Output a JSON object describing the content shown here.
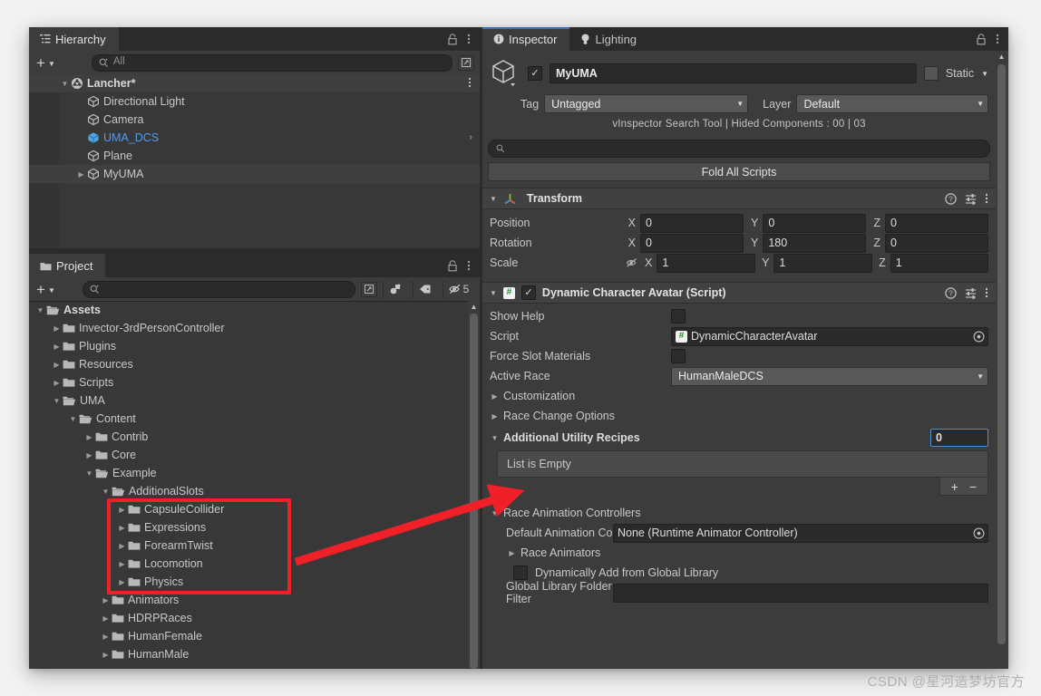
{
  "hierarchy": {
    "tab_label": "Hierarchy",
    "tab_icon": "hierarchy-icon",
    "lock_icon": "lock-icon",
    "menu_icon": "kebab-menu-icon",
    "add_label": "+",
    "search_placeholder": "All",
    "items": [
      {
        "label": "Lancher*",
        "depth": 0,
        "arrow": "down",
        "icon": "unity-scene-icon",
        "bold": true,
        "kebab": true
      },
      {
        "label": "Directional Light",
        "depth": 1,
        "arrow": "none",
        "icon": "gameobject-icon"
      },
      {
        "label": "Camera",
        "depth": 1,
        "arrow": "none",
        "icon": "gameobject-icon"
      },
      {
        "label": "UMA_DCS",
        "depth": 1,
        "arrow": "none",
        "icon": "prefab-icon",
        "color": "#4e9bf0",
        "chevron": true
      },
      {
        "label": "Plane",
        "depth": 1,
        "arrow": "none",
        "icon": "gameobject-icon"
      },
      {
        "label": "MyUMA",
        "depth": 1,
        "arrow": "right",
        "icon": "gameobject-icon",
        "selected": true
      }
    ]
  },
  "project": {
    "tab_label": "Project",
    "tab_icon": "folder-icon",
    "lock_icon": "lock-icon",
    "menu_icon": "kebab-menu-icon",
    "add_label": "+",
    "search_placeholder": "",
    "toolbar_icons": [
      "save-search-icon",
      "label-filter-icon",
      "hidden-toggle-icon"
    ],
    "hidden_count": "5",
    "items": [
      {
        "label": "Assets",
        "depth": 0,
        "arrow": "down",
        "icon": "folder-open-icon",
        "bold": true
      },
      {
        "label": "Invector-3rdPersonController",
        "depth": 1,
        "arrow": "right",
        "icon": "folder-icon"
      },
      {
        "label": "Plugins",
        "depth": 1,
        "arrow": "right",
        "icon": "folder-icon"
      },
      {
        "label": "Resources",
        "depth": 1,
        "arrow": "right",
        "icon": "folder-icon"
      },
      {
        "label": "Scripts",
        "depth": 1,
        "arrow": "right",
        "icon": "folder-icon"
      },
      {
        "label": "UMA",
        "depth": 1,
        "arrow": "down",
        "icon": "folder-open-icon"
      },
      {
        "label": "Content",
        "depth": 2,
        "arrow": "down",
        "icon": "folder-open-icon"
      },
      {
        "label": "Contrib",
        "depth": 3,
        "arrow": "right",
        "icon": "folder-icon"
      },
      {
        "label": "Core",
        "depth": 3,
        "arrow": "right",
        "icon": "folder-icon"
      },
      {
        "label": "Example",
        "depth": 3,
        "arrow": "down",
        "icon": "folder-open-icon"
      },
      {
        "label": "AdditionalSlots",
        "depth": 4,
        "arrow": "down",
        "icon": "folder-open-icon"
      },
      {
        "label": "CapsuleCollider",
        "depth": 5,
        "arrow": "right",
        "icon": "folder-icon"
      },
      {
        "label": "Expressions",
        "depth": 5,
        "arrow": "right",
        "icon": "folder-icon"
      },
      {
        "label": "ForearmTwist",
        "depth": 5,
        "arrow": "right",
        "icon": "folder-icon"
      },
      {
        "label": "Locomotion",
        "depth": 5,
        "arrow": "right",
        "icon": "folder-icon"
      },
      {
        "label": "Physics",
        "depth": 5,
        "arrow": "right",
        "icon": "folder-icon"
      },
      {
        "label": "Animators",
        "depth": 4,
        "arrow": "right",
        "icon": "folder-icon"
      },
      {
        "label": "HDRPRaces",
        "depth": 4,
        "arrow": "right",
        "icon": "folder-icon"
      },
      {
        "label": "HumanFemale",
        "depth": 4,
        "arrow": "right",
        "icon": "folder-icon"
      },
      {
        "label": "HumanMale",
        "depth": 4,
        "arrow": "right",
        "icon": "folder-icon"
      }
    ]
  },
  "inspector": {
    "tabs": [
      {
        "label": "Inspector",
        "icon": "info-icon",
        "active": true
      },
      {
        "label": "Lighting",
        "icon": "light-bulb-icon",
        "active": false
      }
    ],
    "lock_icon": "lock-icon",
    "menu_icon": "kebab-menu-icon",
    "object_icon": "gameobject-icon",
    "enabled_checked": true,
    "object_name": "MyUMA",
    "static_label": "Static",
    "tag_label": "Tag",
    "tag_value": "Untagged",
    "layer_label": "Layer",
    "layer_value": "Default",
    "vinspector_note": "vInspector Search Tool | Hided Components : 00 | 03",
    "search_placeholder": "",
    "fold_all_label": "Fold All Scripts",
    "transform": {
      "title": "Transform",
      "icon": "transform-axis-icon",
      "help_icon": "help-icon",
      "preset_icon": "preset-icon",
      "menu_icon": "kebab-menu-icon",
      "rows": [
        {
          "label": "Position",
          "x": "0",
          "y": "0",
          "z": "0",
          "eye": false
        },
        {
          "label": "Rotation",
          "x": "0",
          "y": "180",
          "z": "0",
          "eye": false
        },
        {
          "label": "Scale",
          "x": "1",
          "y": "1",
          "z": "1",
          "eye": true
        }
      ],
      "axis_labels": [
        "X",
        "Y",
        "Z"
      ]
    },
    "dca": {
      "title": "Dynamic Character Avatar (Script)",
      "icon": "cs-script-icon",
      "enabled_checked": true,
      "help_icon": "help-icon",
      "preset_icon": "preset-icon",
      "menu_icon": "kebab-menu-icon",
      "show_help_label": "Show Help",
      "show_help_checked": false,
      "script_label": "Script",
      "script_value": "DynamicCharacterAvatar",
      "script_picker_icon": "object-picker-icon",
      "force_slot_label": "Force Slot Materials",
      "force_slot_checked": false,
      "active_race_label": "Active Race",
      "active_race_value": "HumanMaleDCS",
      "customization_label": "Customization",
      "race_change_label": "Race Change Options",
      "utility_recipes_label": "Additional Utility Recipes",
      "utility_recipes_size": "0",
      "list_empty_label": "List is Empty",
      "list_add_label": "+",
      "list_remove_label": "−",
      "race_anim_label": "Race Animation Controllers",
      "default_anim_label": "Default Animation Controlle",
      "default_anim_value": "None (Runtime Animator Controller)",
      "default_anim_picker_icon": "object-picker-icon",
      "race_animators_label": "Race Animators",
      "dynamic_add_label": "Dynamically Add from Global Library",
      "dynamic_add_checked": false,
      "global_filter_label": "Global Library Folder Filter",
      "global_filter_value": ""
    }
  },
  "annotations": {
    "highlight_box_name": "additional-slots-highlight",
    "arrow_name": "callout-arrow",
    "color": "#ef2028"
  },
  "watermark": "CSDN @星河造梦坊官方"
}
